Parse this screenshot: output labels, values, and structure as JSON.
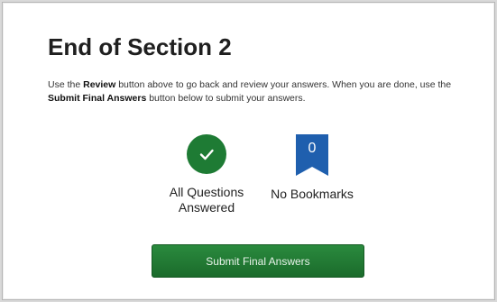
{
  "page": {
    "title": "End of Section 2",
    "instructions": {
      "part1": "Use the ",
      "review_bold": "Review",
      "part2": " button above to go back and review your answers. When you are done, use the ",
      "submit_bold": "Submit Final Answers",
      "part3": " button below to submit your answers."
    }
  },
  "status": {
    "answered": {
      "icon": "checkmark-icon",
      "label_line1": "All Questions",
      "label_line2": "Answered"
    },
    "bookmarks": {
      "icon": "bookmark-icon",
      "count": "0",
      "label": "No Bookmarks"
    }
  },
  "submit_button": {
    "label": "Submit Final Answers"
  },
  "colors": {
    "accent_green": "#1e7b34",
    "bookmark_blue": "#1f5fae",
    "background": "#ffffff"
  }
}
